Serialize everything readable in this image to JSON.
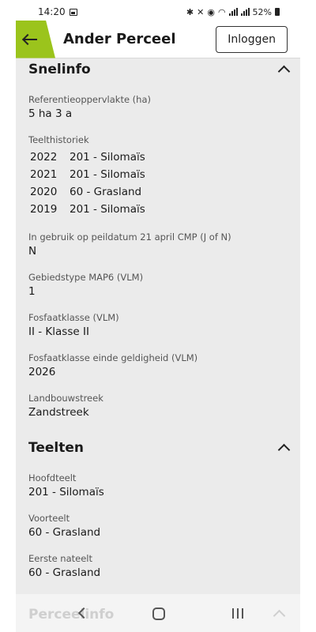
{
  "status_bar": {
    "time": "14:20",
    "battery": "52%"
  },
  "header": {
    "title": "Ander Perceel",
    "login_label": "Inloggen"
  },
  "snelinfo": {
    "title": "Snelinfo",
    "referentie_label": "Referentieoppervlakte (ha)",
    "referentie_value": "5 ha 3 a",
    "teelthistoriek_label": "Teelthistoriek",
    "history": [
      {
        "year": "2022",
        "crop": "201 - Silomaïs"
      },
      {
        "year": "2021",
        "crop": "201 - Silomaïs"
      },
      {
        "year": "2020",
        "crop": "60 - Grasland"
      },
      {
        "year": "2019",
        "crop": "201 - Silomaïs"
      }
    ],
    "ingebruik_label": "In gebruik op peildatum 21 april CMP (J of N)",
    "ingebruik_value": "N",
    "gebiedstype_label": "Gebiedstype MAP6 (VLM)",
    "gebiedstype_value": "1",
    "fosfaat_label": "Fosfaatklasse (VLM)",
    "fosfaat_value": "II - Klasse II",
    "fosfaat_einde_label": "Fosfaatklasse einde geldigheid (VLM)",
    "fosfaat_einde_value": "2026",
    "landbouwstreek_label": "Landbouwstreek",
    "landbouwstreek_value": "Zandstreek"
  },
  "teelten": {
    "title": "Teelten",
    "hoofdteelt_label": "Hoofdteelt",
    "hoofdteelt_value": "201 - Silomaïs",
    "voorteelt_label": "Voorteelt",
    "voorteelt_value": "60 - Grasland",
    "nateelt_label": "Eerste nateelt",
    "nateelt_value": "60 - Grasland"
  },
  "bottom": {
    "label": "Perceelinfo"
  },
  "colors": {
    "accent": "#9bc41c",
    "background": "#ebebeb"
  }
}
